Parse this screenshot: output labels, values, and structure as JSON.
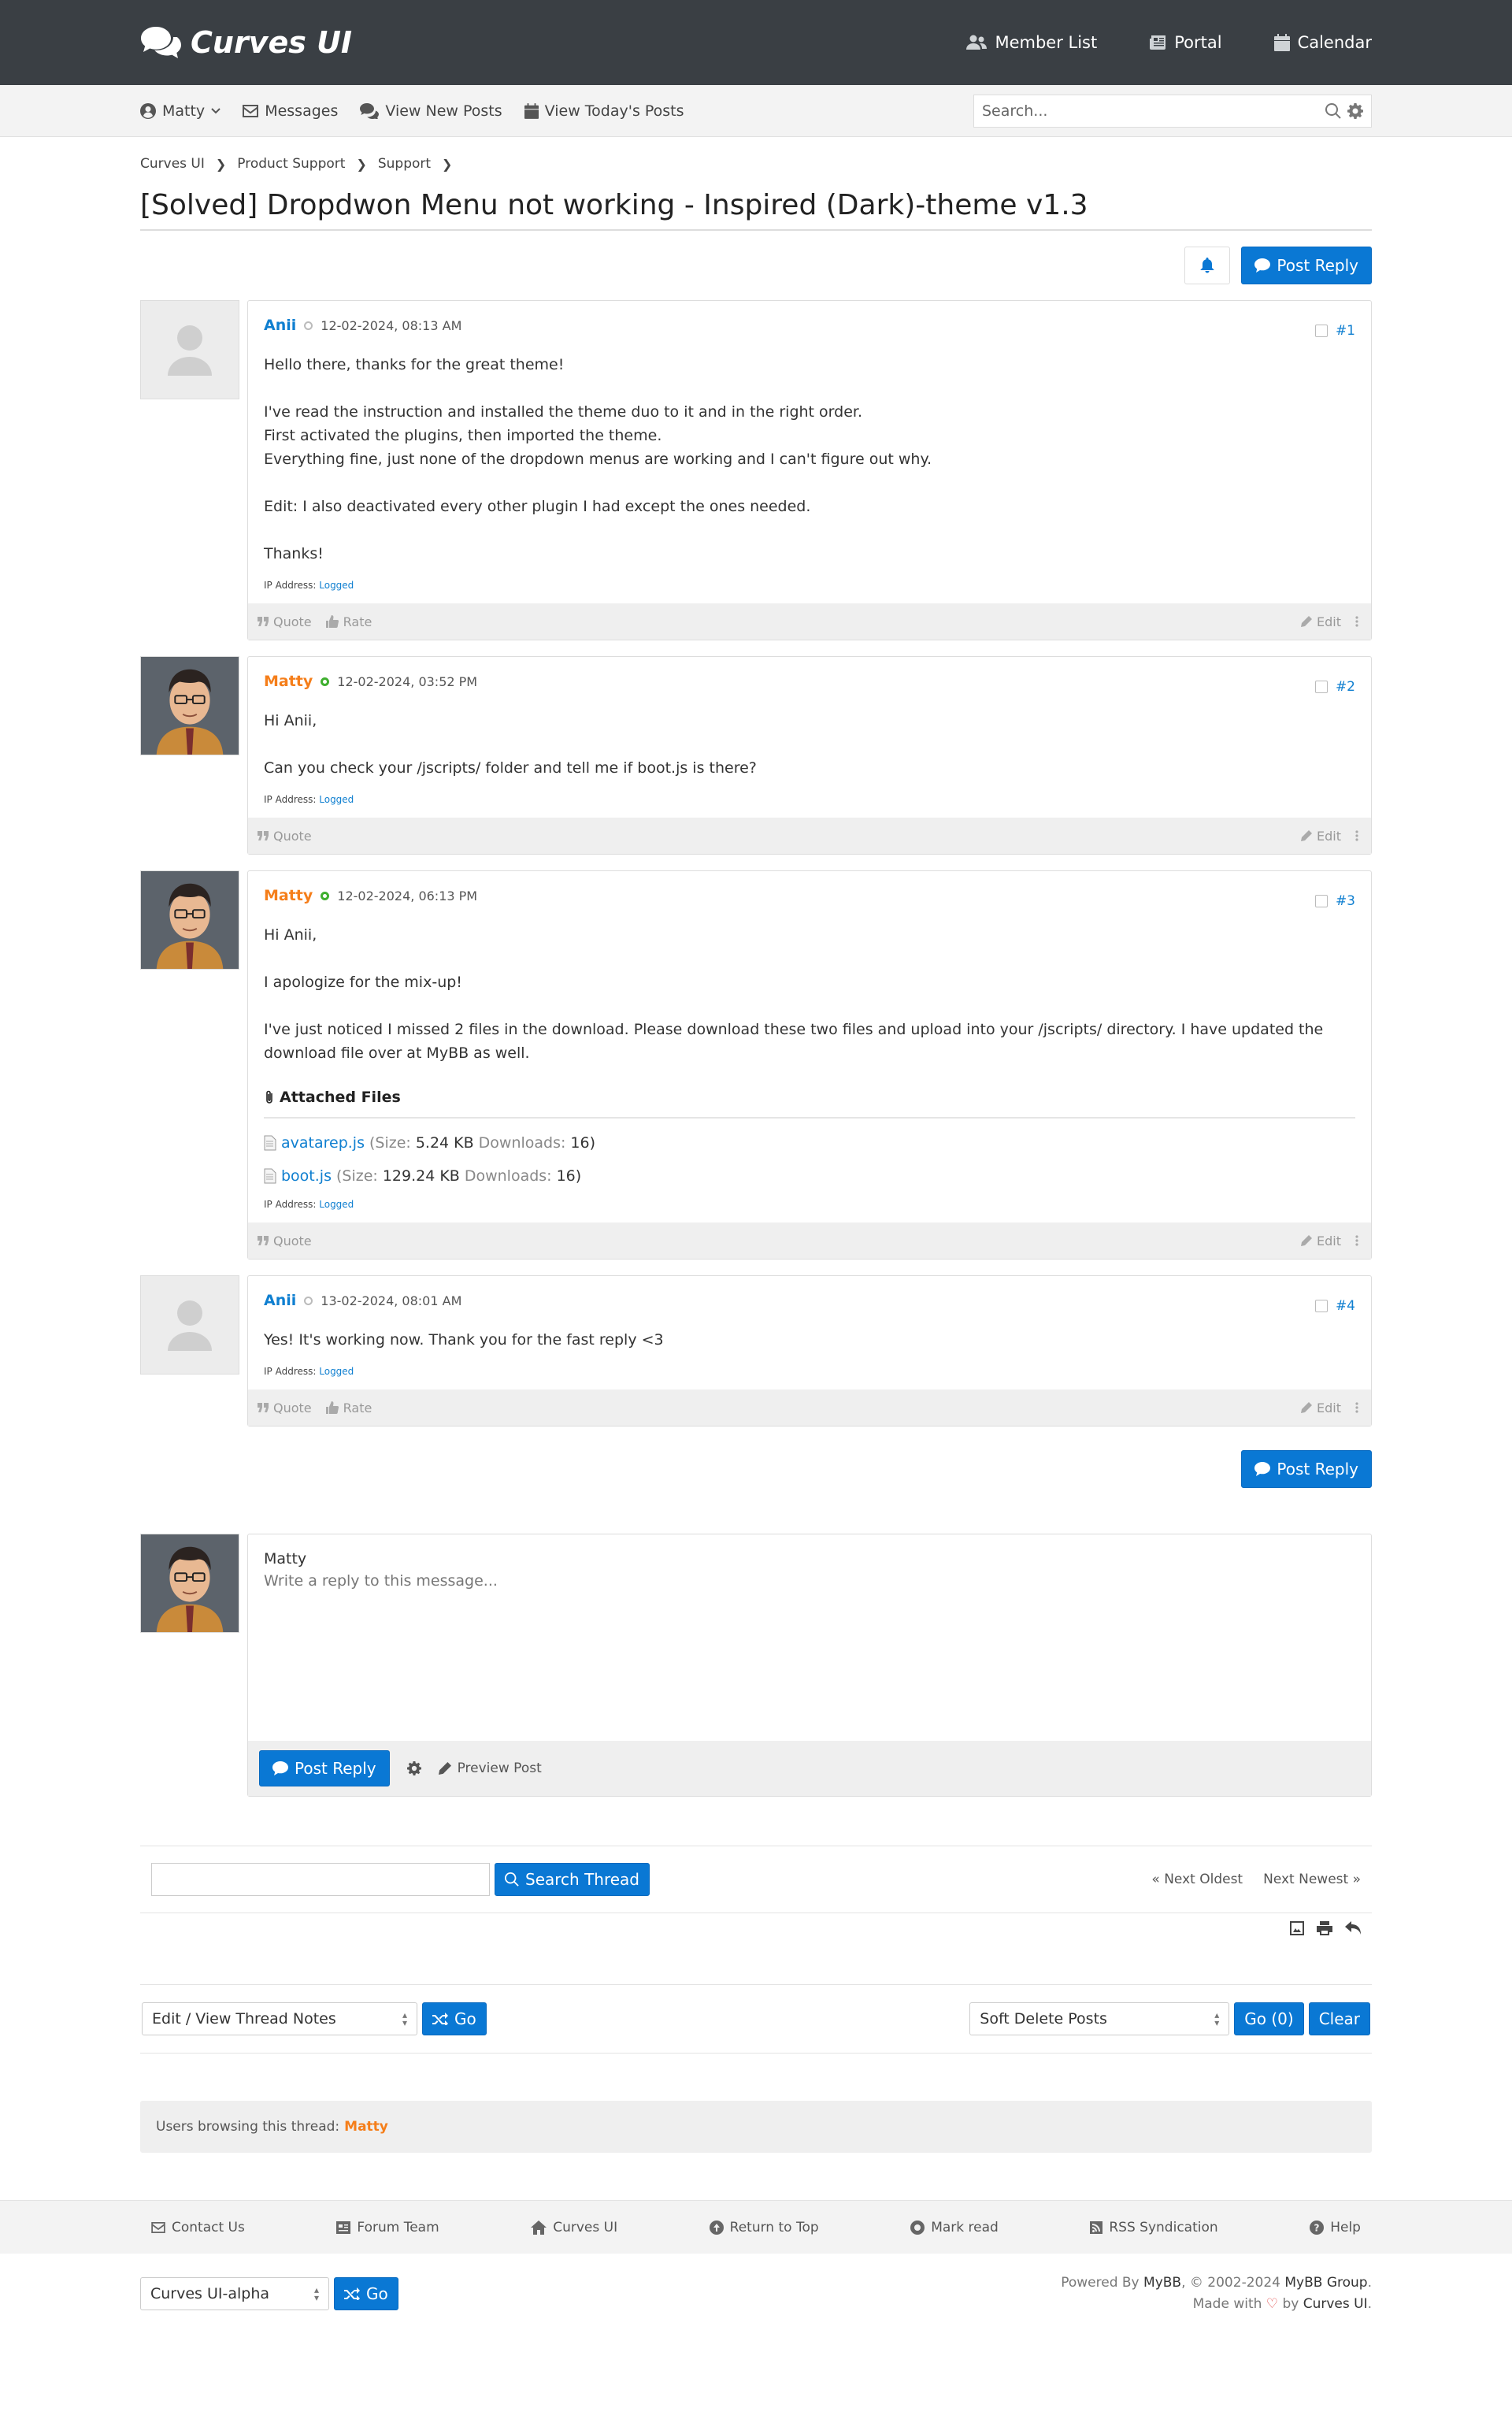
{
  "header": {
    "logo_text": "Curves UI",
    "nav": [
      {
        "label": "Member List",
        "icon": "users-icon"
      },
      {
        "label": "Portal",
        "icon": "newspaper-icon"
      },
      {
        "label": "Calendar",
        "icon": "calendar-icon"
      }
    ]
  },
  "userbar": {
    "user": "Matty",
    "messages": "Messages",
    "new_posts": "View New Posts",
    "todays_posts": "View Today's Posts",
    "search_placeholder": "Search..."
  },
  "breadcrumb": [
    "Curves UI",
    "Product Support",
    "Support"
  ],
  "thread": {
    "title": "[Solved] Dropdwon Menu not working - Inspired (Dark)-theme v1.3",
    "post_reply": "Post Reply"
  },
  "posts": [
    {
      "author": "Anii",
      "date": "12-02-2024, 08:13 AM",
      "number": "#1",
      "lines": [
        "Hello there, thanks for the great theme!",
        "",
        "I've read the instruction and installed the theme duo to it and in the right order.",
        "First activated the plugins, then imported the theme.",
        "Everything fine, just none of the dropdown menus are working and I can't figure out why.",
        "",
        "Edit: I also deactivated every other plugin I had except the ones needed.",
        "",
        "Thanks!"
      ],
      "ip_label": "IP Address:",
      "ip_value": "Logged",
      "quote": "Quote",
      "rate": "Rate",
      "edit": "Edit"
    },
    {
      "author": "Matty",
      "date": "12-02-2024, 03:52 PM",
      "number": "#2",
      "lines": [
        "Hi Anii,",
        "",
        "Can you check your /jscripts/ folder and tell me if boot.js is there?"
      ],
      "ip_label": "IP Address:",
      "ip_value": "Logged",
      "quote": "Quote",
      "edit": "Edit"
    },
    {
      "author": "Matty",
      "date": "12-02-2024, 06:13 PM",
      "number": "#3",
      "lines": [
        "Hi Anii,",
        "",
        "I apologize for the mix-up!",
        "",
        "I've just noticed I missed 2 files in the download. Please download these two files and upload into your /jscripts/ directory. I have updated the download file over at MyBB as well."
      ],
      "attached_title": "Attached Files",
      "attachments": [
        {
          "name": "avatarep.js",
          "size_label": "(Size:",
          "size": "5.24 KB",
          "dl_label": "Downloads:",
          "downloads": "16)"
        },
        {
          "name": "boot.js",
          "size_label": "(Size:",
          "size": "129.24 KB",
          "dl_label": "Downloads:",
          "downloads": "16)"
        }
      ],
      "ip_label": "IP Address:",
      "ip_value": "Logged",
      "quote": "Quote",
      "edit": "Edit"
    },
    {
      "author": "Anii",
      "date": "13-02-2024, 08:01 AM",
      "number": "#4",
      "lines": [
        "Yes! It's working now. Thank you for the fast reply <3"
      ],
      "ip_label": "IP Address:",
      "ip_value": "Logged",
      "quote": "Quote",
      "rate": "Rate",
      "edit": "Edit"
    }
  ],
  "quick_reply": {
    "user": "Matty",
    "placeholder": "Write a reply to this message...",
    "post_reply": "Post Reply",
    "preview": "Preview Post"
  },
  "thread_tools": {
    "search_button": "Search Thread",
    "next_oldest": "Next Oldest",
    "next_newest": "Next Newest"
  },
  "moderation": {
    "notes_select": "Edit / View Thread Notes",
    "go": "Go",
    "soft_delete_select": "Soft Delete Posts",
    "go_count": "Go (0)",
    "clear": "Clear"
  },
  "browsing": {
    "label": "Users browsing this thread:",
    "user": "Matty"
  },
  "footer": {
    "links": [
      "Contact Us",
      "Forum Team",
      "Curves UI",
      "Return to Top",
      "Mark read",
      "RSS Syndication",
      "Help"
    ],
    "theme_select": "Curves UI-alpha",
    "go": "Go",
    "powered_by": "Powered By",
    "mybb": "MyBB",
    "copyright": ", © 2002-2024",
    "mybb_group": "MyBB Group",
    "made_with": "Made with",
    "by": "by",
    "curves": "Curves UI"
  },
  "colors": {
    "accent": "#0a78d4",
    "header_bg": "#3a3f44",
    "orange_user": "#f57e1a",
    "blue_user": "#0f7fd0"
  }
}
